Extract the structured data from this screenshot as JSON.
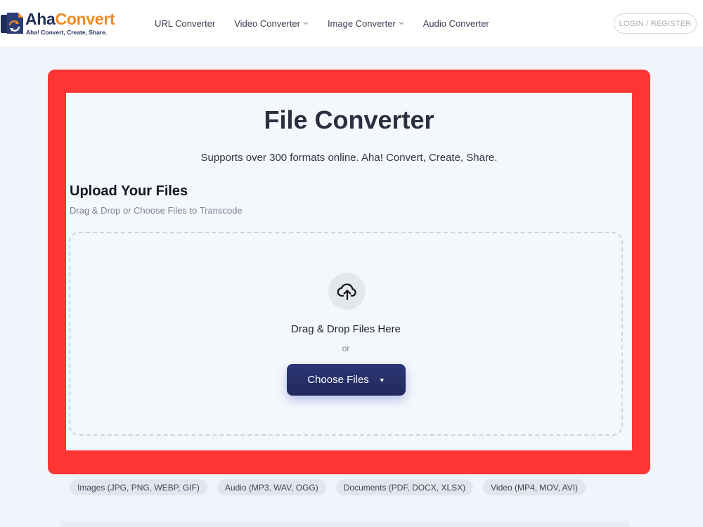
{
  "brand": {
    "name_part1": "Aha",
    "name_part2": "Convert",
    "tagline": "Aha! Convert, Create, Share.",
    "accent_color": "#f08a24",
    "primary_color": "#1f2d5a"
  },
  "nav": {
    "items": [
      {
        "label": "URL Converter",
        "has_dropdown": false
      },
      {
        "label": "Video Converter",
        "has_dropdown": true
      },
      {
        "label": "Image Converter",
        "has_dropdown": true
      },
      {
        "label": "Audio Converter",
        "has_dropdown": false
      }
    ],
    "login_label": "LOGIN / REGISTER"
  },
  "main": {
    "title": "File Converter",
    "subtitle": "Supports over 300 formats online. Aha! Convert, Create, Share.",
    "upload_heading": "Upload Your Files",
    "upload_subheading": "Drag & Drop or Choose Files to Transcode",
    "dropzone": {
      "icon": "cloud-upload-icon",
      "drop_text": "Drag & Drop Files Here",
      "or_text": "or",
      "button_label": "Choose Files",
      "button_caret": "▼"
    },
    "highlight_color": "#ff3535"
  },
  "formats": [
    "Images (JPG, PNG, WEBP, GIF)",
    "Audio (MP3, WAV, OGG)",
    "Documents (PDF, DOCX, XLSX)",
    "Video (MP4, MOV, AVI)"
  ]
}
